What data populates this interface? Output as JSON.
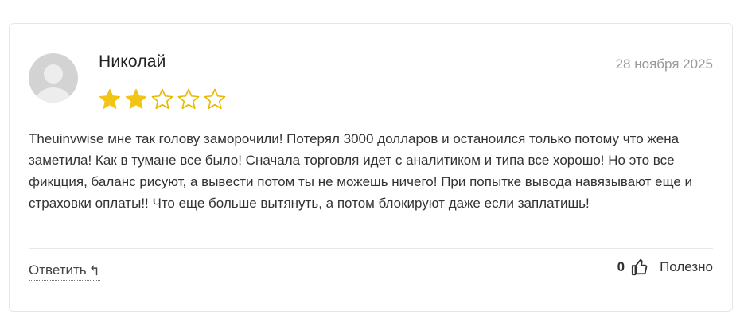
{
  "review": {
    "author": "Николай",
    "date": "28 ноября 2025",
    "rating": 2,
    "rating_max": 5,
    "text": "Theuinvwise мне так голову заморочили! Потерял 3000 долларов и останоился только потому что жена заметила! Как в тумане все было! Сначала торговля идет с аналитиком и типа все хорошо! Но это все фикцция, баланс рисуют, а вывести потом ты не можешь ничего! При попытке вывода навязывают еще и страховки оплаты!! Что еще больше вытянуть, а потом блокируют даже если заплатишь!",
    "reply_label": "Ответить",
    "reply_icon": "↰",
    "helpful_count": "0",
    "helpful_label": "Полезно"
  },
  "icons": {
    "avatar": "user-avatar-placeholder",
    "star": "star-icon",
    "reply": "reply-arrow-icon",
    "thumb": "thumbs-up-icon"
  },
  "colors": {
    "star_fill": "#f2c416",
    "star_outline": "#e6b800",
    "avatar_bg": "#d3d3d3",
    "avatar_fg": "#ededed",
    "muted_text": "#9a9a9a"
  }
}
